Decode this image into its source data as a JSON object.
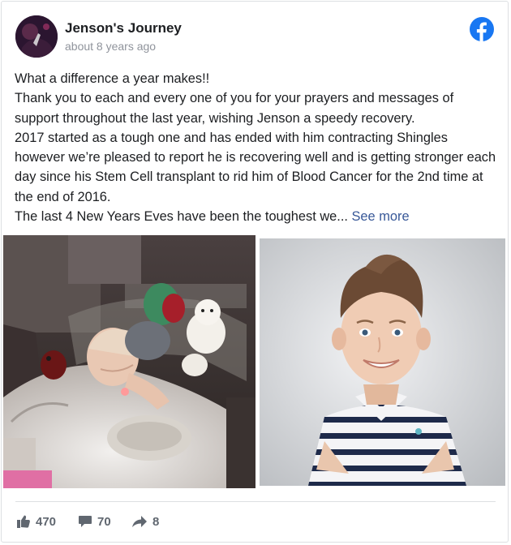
{
  "post": {
    "page_name": "Jenson's Journey",
    "timestamp": "about 8 years ago",
    "paragraphs": [
      "What a difference a year makes!!",
      "Thank you to each and every one of you for your prayers and messages of support throughout the last year, wishing Jenson a speedy recovery.",
      "2017 started as a tough one and has ended with him contracting Shingles however we’re pleased to report he is recovering well and is getting stronger each day since his Stem Cell transplant to rid him of Blood Cancer for the 2nd time at the end of 2016."
    ],
    "last_line": "The last 4 New Years Eves have been the toughest we...",
    "see_more": "See more"
  },
  "stats": {
    "likes": "470",
    "comments": "70",
    "shares": "8"
  },
  "colors": {
    "facebook_blue": "#1877f2",
    "link": "#385898",
    "muted": "#606770"
  },
  "icons": {
    "brand": "facebook-icon",
    "like": "thumbs-up-icon",
    "comment": "comment-icon",
    "share": "share-arrow-icon"
  }
}
